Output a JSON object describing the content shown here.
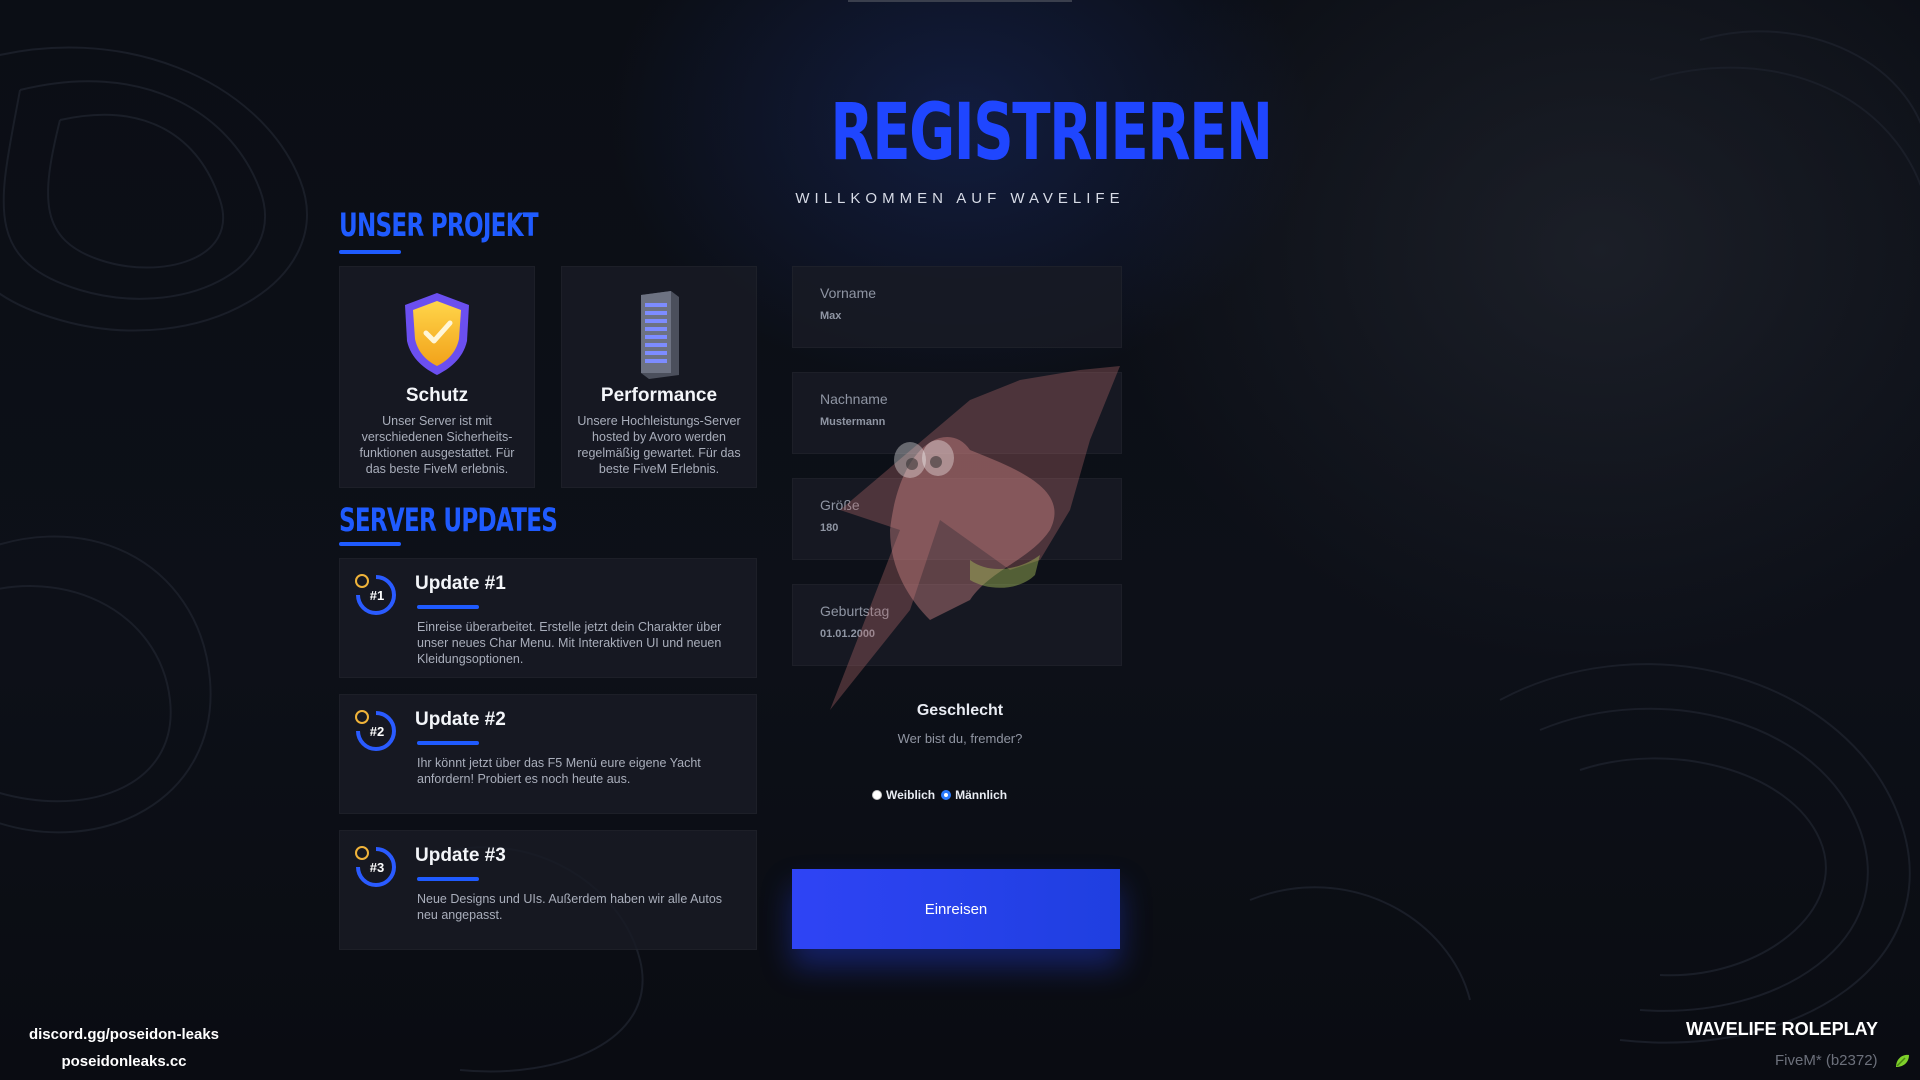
{
  "header": {
    "title": "REGISTRIEREN",
    "subtitle": "WILLKOMMEN AUF WAVELIFE"
  },
  "project": {
    "title": "UNSER PROJEKT",
    "cards": [
      {
        "icon": "shield-check-icon",
        "title": "Schutz",
        "text": "Unser Server ist mit verschiedenen Sicherheits-funktionen ausgestattet. Für das beste FiveM erlebnis."
      },
      {
        "icon": "server-rack-icon",
        "title": "Performance",
        "text": "Unsere Hochleistungs-Server hosted by Avoro werden regelmäßig gewartet. Für das beste FiveM Erlebnis."
      }
    ]
  },
  "updates": {
    "title": "SERVER UPDATES",
    "items": [
      {
        "badge": "#1",
        "title": "Update #1",
        "text": "Einreise überarbeitet. Erstelle jetzt dein Charakter über unser neues Char Menu. Mit Interaktiven UI und neuen Kleidungsoptionen."
      },
      {
        "badge": "#2",
        "title": "Update #2",
        "text": "Ihr könnt jetzt über das F5 Menü eure eigene Yacht anfordern! Probiert es noch heute aus."
      },
      {
        "badge": "#3",
        "title": "Update #3",
        "text": "Neue Designs und UIs. Außerdem haben wir alle Autos neu angepasst."
      }
    ]
  },
  "form": {
    "fields": [
      {
        "label": "Vorname",
        "placeholder": "Max"
      },
      {
        "label": "Nachname",
        "placeholder": "Mustermann"
      },
      {
        "label": "Größe",
        "placeholder": "180"
      },
      {
        "label": "Geburtstag",
        "placeholder": "01.01.2000"
      }
    ],
    "gender": {
      "title": "Geschlecht",
      "subtitle": "Wer bist du, fremder?",
      "options": [
        "Weiblich",
        "Männlich"
      ],
      "selected": "Männlich"
    },
    "submit_label": "Einreisen"
  },
  "footer": {
    "discord": "discord.gg/poseidon-leaks",
    "site": "poseidonleaks.cc",
    "brand": "WAVELIFE ROLEPLAY",
    "build": "FiveM* (b2372)"
  },
  "colors": {
    "accent": "#1f5bff",
    "button": "#2f44f5",
    "card_bg": "#181b24",
    "page_bg": "#0b0e14"
  }
}
